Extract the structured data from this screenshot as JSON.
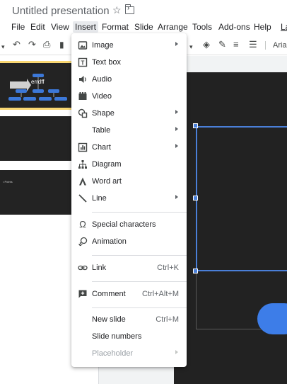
{
  "title": "Untitled presentation",
  "menubar": {
    "items": [
      "File",
      "Edit",
      "View",
      "Insert",
      "Format",
      "Slide",
      "Arrange",
      "Tools",
      "Add-ons",
      "Help",
      "La"
    ],
    "active": "Insert"
  },
  "toolbar": {
    "font": "Arial"
  },
  "thumbnails": {
    "slide1_text": "errdff",
    "slide3_text": "• Points"
  },
  "insert_menu": {
    "items": [
      {
        "label": "Image",
        "icon": "image-icon",
        "submenu": true
      },
      {
        "label": "Text box",
        "icon": "text-box-icon"
      },
      {
        "label": "Audio",
        "icon": "audio-icon"
      },
      {
        "label": "Video",
        "icon": "video-icon"
      },
      {
        "label": "Shape",
        "icon": "shape-icon",
        "submenu": true
      },
      {
        "label": "Table",
        "icon": "",
        "submenu": true
      },
      {
        "label": "Chart",
        "icon": "chart-icon",
        "submenu": true
      },
      {
        "label": "Diagram",
        "icon": "diagram-icon"
      },
      {
        "label": "Word art",
        "icon": "word-art-icon"
      },
      {
        "label": "Line",
        "icon": "line-icon",
        "submenu": true
      },
      {
        "label": "Special characters",
        "icon": "omega-icon"
      },
      {
        "label": "Animation",
        "icon": "animation-icon"
      },
      {
        "label": "Link",
        "icon": "link-icon",
        "shortcut": "Ctrl+K"
      },
      {
        "label": "Comment",
        "icon": "add-comment-icon",
        "shortcut": "Ctrl+Alt+M"
      },
      {
        "label": "New slide",
        "icon": "",
        "shortcut": "Ctrl+M"
      },
      {
        "label": "Slide numbers",
        "icon": ""
      },
      {
        "label": "Placeholder",
        "icon": "",
        "submenu": true,
        "disabled": true
      }
    ]
  },
  "colors": {
    "accent": "#4a7fd8",
    "selected_thumb": "#f9d772",
    "slide_bg": "#222222"
  }
}
